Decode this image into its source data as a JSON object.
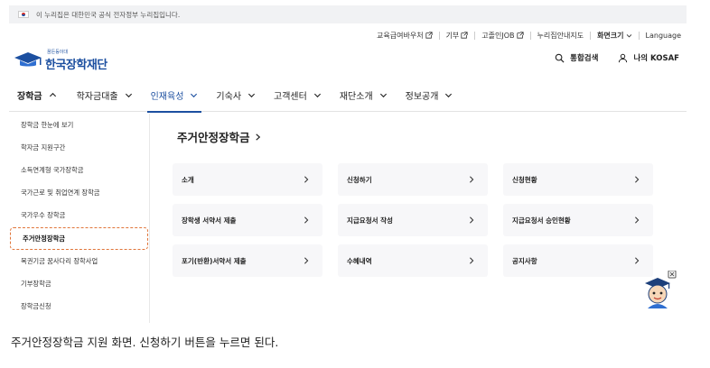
{
  "gov_banner": {
    "text": "이 누리집은 대한민국 공식 전자정부 누리집입니다."
  },
  "util_links": [
    {
      "label": "교육급여바우처",
      "external": true
    },
    {
      "label": "기부",
      "external": true
    },
    {
      "label": "고졸인JOB",
      "external": true
    },
    {
      "label": "누리집안내지도",
      "external": false
    },
    {
      "label": "화면크기",
      "dropdown": true,
      "bold": true
    },
    {
      "label": "Language",
      "external": false
    }
  ],
  "logo": {
    "sub": "꿈든등이대",
    "name": "한국장학재단"
  },
  "header_actions": {
    "search": "통합검색",
    "mypage": "나의 KOSAF"
  },
  "gnb": [
    {
      "label": "장학금"
    },
    {
      "label": "학자금대출"
    },
    {
      "label": "인재육성"
    },
    {
      "label": "기숙사"
    },
    {
      "label": "고객센터"
    },
    {
      "label": "재단소개"
    },
    {
      "label": "정보공개"
    }
  ],
  "sidebar": [
    "장학금 한눈에 보기",
    "학자금 지원구간",
    "소득연계형 국가장학금",
    "국가근로 및 취업연계 장학금",
    "국가우수 장학금",
    "주거안정장학금",
    "복권기금 꿈사다리 장학사업",
    "기부장학금",
    "장학금신청"
  ],
  "sidebar_selected_index": 5,
  "main": {
    "title": "주거안정장학금",
    "cards": [
      [
        "소개",
        "신청하기",
        "신청현황"
      ],
      [
        "장학생 서약서 제출",
        "지급요청서 작성",
        "지급요청서 승인현황"
      ],
      [
        "포기(반환)서약서 제출",
        "수혜내역",
        "공지사항"
      ]
    ]
  },
  "caption": "주거안정장학금 지원 화면. 신청하기 버튼을 누르면 된다.",
  "colors": {
    "brand": "#1c4fa0",
    "selected_outline": "#e0753a",
    "card_bg": "#f7f7f9"
  }
}
